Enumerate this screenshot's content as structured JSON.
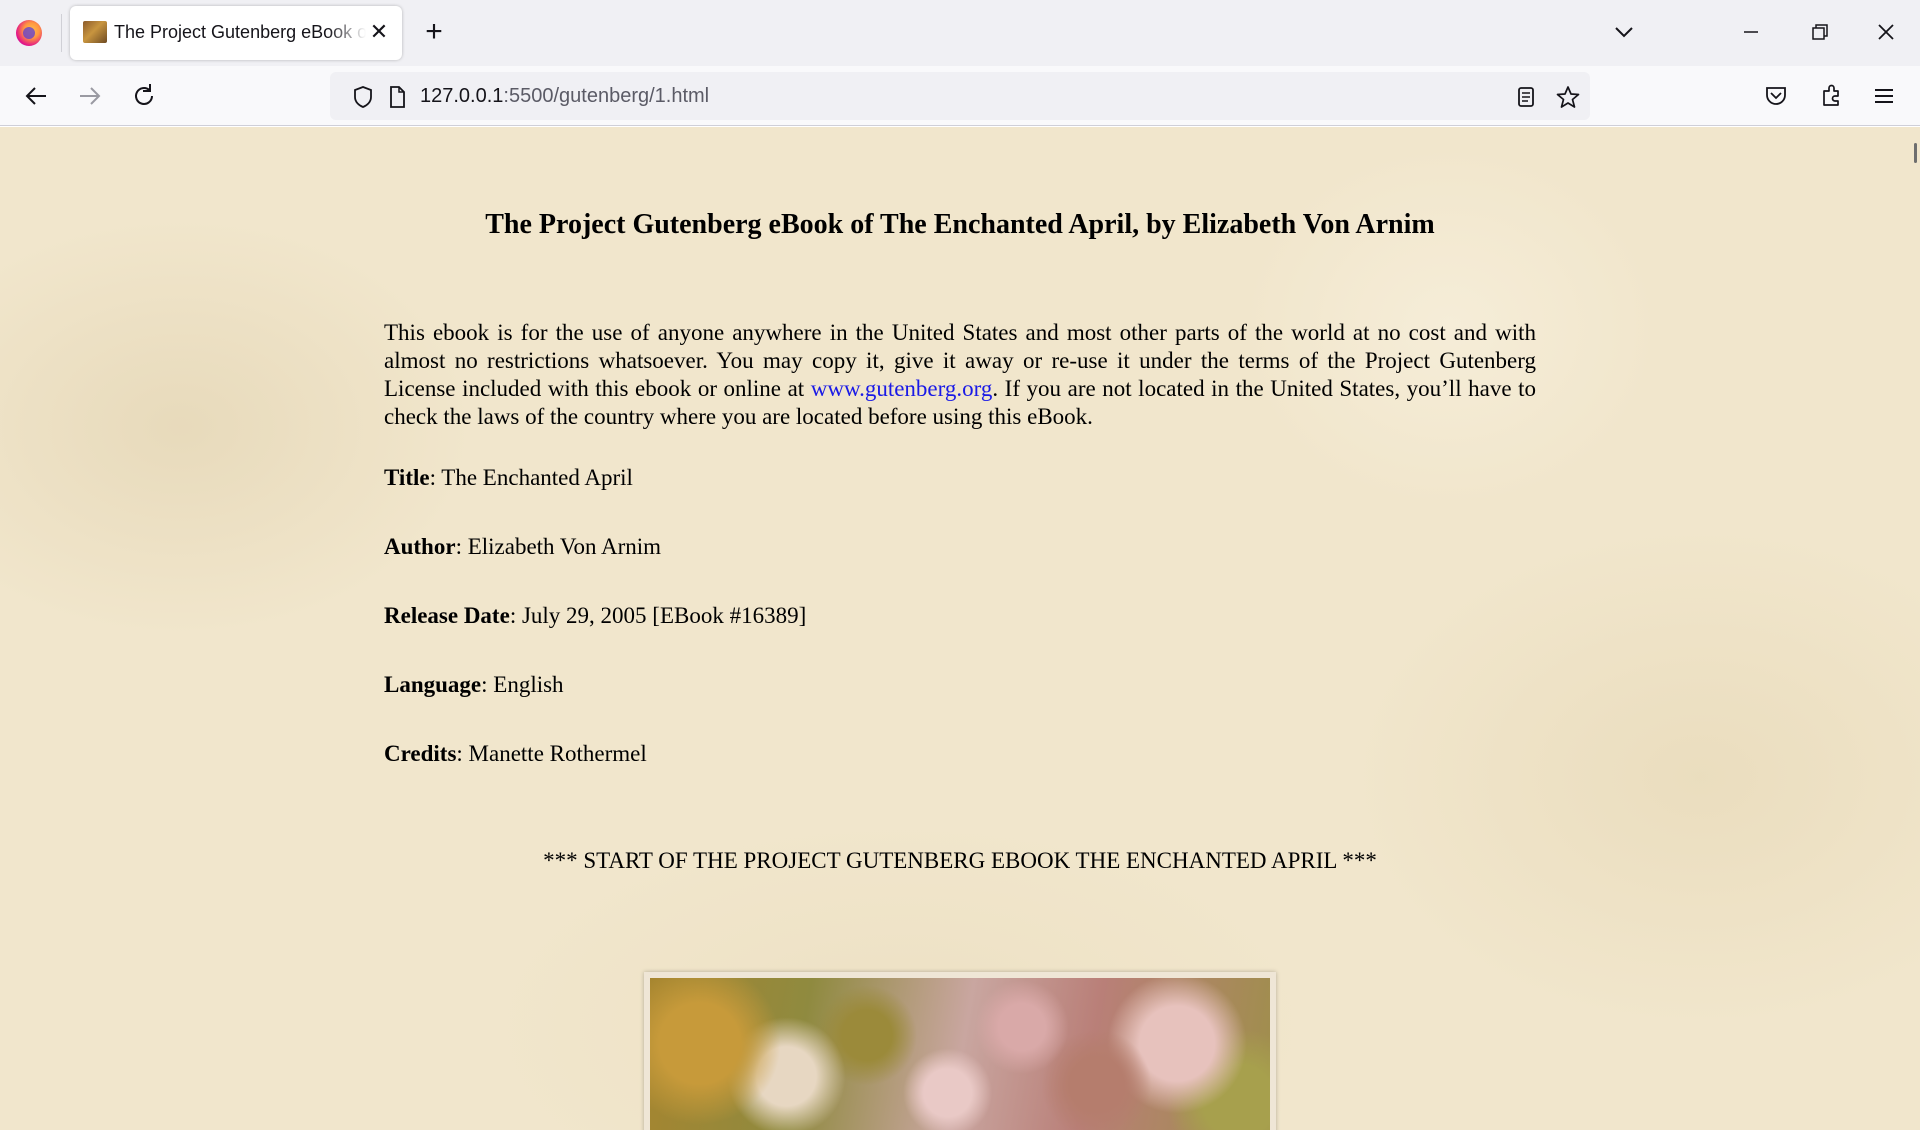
{
  "browser": {
    "tab": {
      "title": "The Project Gutenberg eBook of The Enchanted April, by Elizabeth Von Arnim",
      "favicon": "book-cover-icon",
      "close_icon": "close-icon"
    },
    "new_tab_icon": "plus-icon",
    "tab_list_icon": "chevron-down-icon",
    "window_controls": [
      "minimize-icon",
      "restore-icon",
      "close-icon"
    ],
    "nav": {
      "back_icon": "arrow-left-icon",
      "forward_icon": "arrow-right-icon",
      "reload_icon": "reload-icon"
    },
    "url": {
      "host": "127.0.0.1",
      "rest": ":5500/gutenberg/1.html",
      "security_icon": "shield-icon",
      "page_icon": "page-icon"
    },
    "url_actions": [
      "reader-view-icon",
      "star-icon"
    ],
    "toolbar_icons": [
      "pocket-icon",
      "extensions-icon",
      "menu-icon"
    ]
  },
  "page": {
    "title": "The Project Gutenberg eBook of The Enchanted April, by Elizabeth Von Arnim",
    "intro_before_link": "This ebook is for the use of anyone anywhere in the United States and most other parts of the world at no cost and with almost no restrictions whatsoever. You may copy it, give it away or re-use it under the terms of the Project Gutenberg License included with this ebook or online at ",
    "intro_link": "www.gutenberg.org",
    "intro_after_link": ". If you are not located in the United States, you’ll have to check the laws of the country where you are located before using this eBook.",
    "meta": [
      {
        "label": "Title",
        "value": ": The Enchanted April"
      },
      {
        "label": "Author",
        "value": ": Elizabeth Von Arnim"
      },
      {
        "label": "Release Date",
        "value": ": July 29, 2005 [EBook #16389]"
      },
      {
        "label": "Language",
        "value": ": English"
      },
      {
        "label": "Credits",
        "value": ": Manette Rothermel"
      }
    ],
    "start_line": "*** START OF THE PROJECT GUTENBERG EBOOK THE ENCHANTED APRIL ***"
  },
  "colors": {
    "page_background": "#f1e6cc",
    "link": "#1a1ae6",
    "chrome_background": "#f0f0f4"
  }
}
